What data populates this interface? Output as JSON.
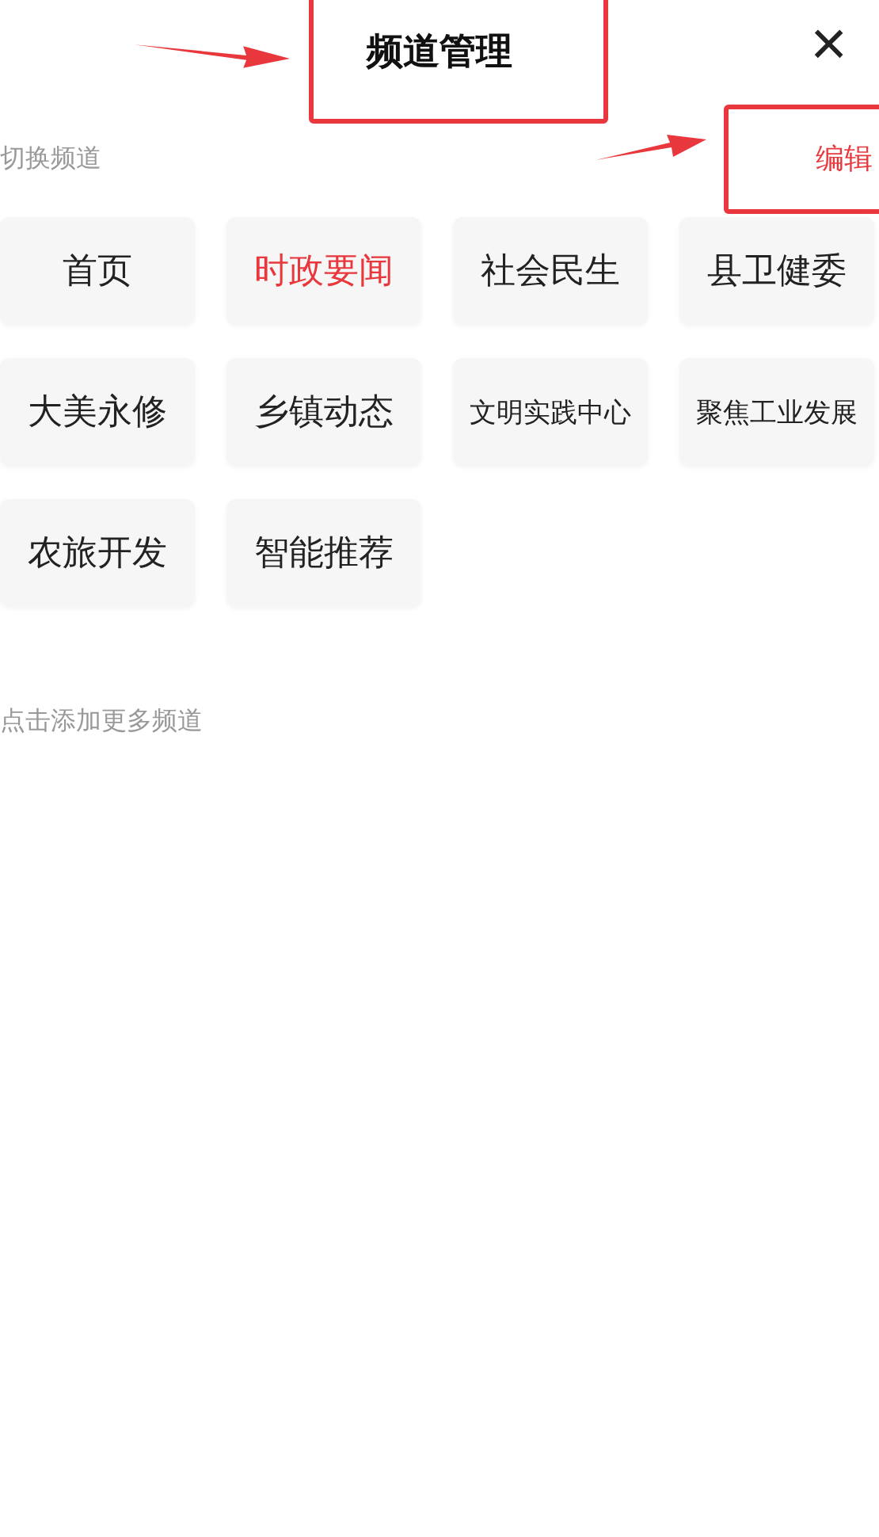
{
  "header": {
    "title": "频道管理",
    "close": "×"
  },
  "section": {
    "label": "切换频道",
    "action": "编辑"
  },
  "channels": [
    {
      "label": "首页",
      "selected": false
    },
    {
      "label": "时政要闻",
      "selected": true
    },
    {
      "label": "社会民生",
      "selected": false
    },
    {
      "label": "县卫健委",
      "selected": false
    },
    {
      "label": "大美永修",
      "selected": false
    },
    {
      "label": "乡镇动态",
      "selected": false
    },
    {
      "label": "文明实践中心",
      "selected": false
    },
    {
      "label": "聚焦工业发展",
      "selected": false
    },
    {
      "label": "农旅开发",
      "selected": false
    },
    {
      "label": "智能推荐",
      "selected": false
    }
  ],
  "more": {
    "label": "点击添加更多频道"
  }
}
